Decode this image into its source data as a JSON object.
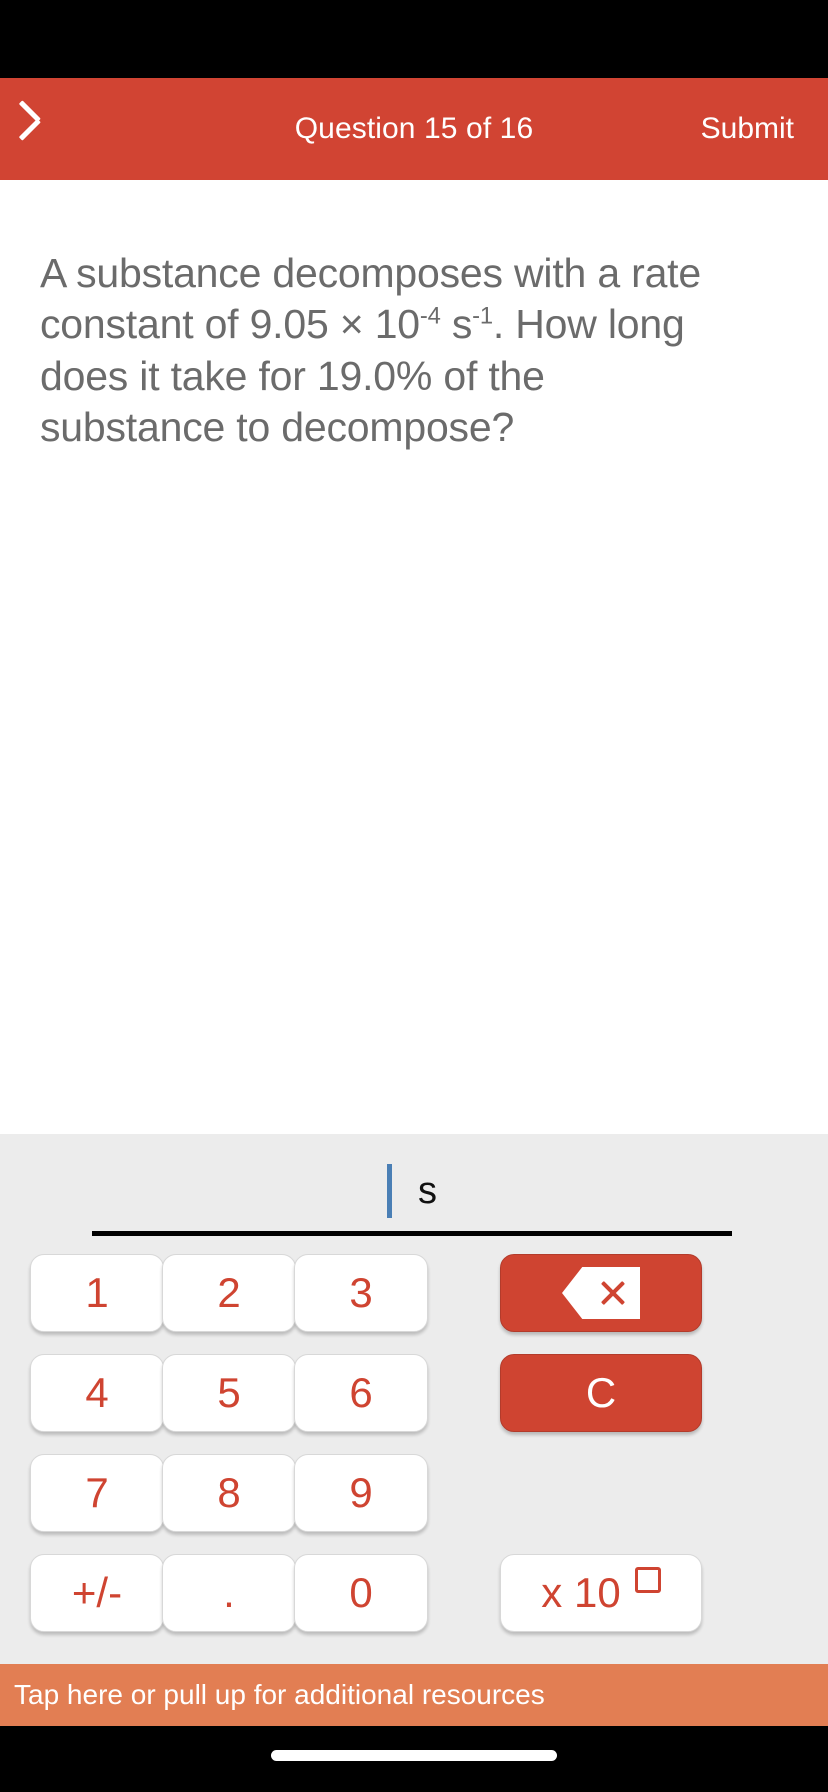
{
  "header": {
    "back_icon": "chevron-left-icon",
    "title": "Question 15 of 16",
    "submit_label": "Submit",
    "background_color": "#d14433",
    "text_color": "#ffffff"
  },
  "question": {
    "line1": "A substance decomposes with a rate constant of 9.05 × 10",
    "exp1": "-4",
    "line1b": " s",
    "exp2": "-1",
    "line1c": ". How long does it take for 19.0% of the substance to decompose?",
    "text_color": "#6b6b6b"
  },
  "answer": {
    "value": "",
    "caret_color": "#4a7fb5",
    "unit": "s",
    "underline_color": "#000000"
  },
  "keypad": {
    "background_color": "#ececec",
    "key_text_color": "#cf4431",
    "action_key_color": "#cf4431",
    "keys": [
      {
        "name": "key-1",
        "label": "1"
      },
      {
        "name": "key-2",
        "label": "2"
      },
      {
        "name": "key-3",
        "label": "3"
      },
      {
        "name": "key-4",
        "label": "4"
      },
      {
        "name": "key-5",
        "label": "5"
      },
      {
        "name": "key-6",
        "label": "6"
      },
      {
        "name": "key-7",
        "label": "7"
      },
      {
        "name": "key-8",
        "label": "8"
      },
      {
        "name": "key-9",
        "label": "9"
      },
      {
        "name": "key-sign",
        "label": "+/-"
      },
      {
        "name": "key-decimal",
        "label": "."
      },
      {
        "name": "key-0",
        "label": "0"
      }
    ],
    "backspace": {
      "icon": "backspace-icon",
      "label": ""
    },
    "clear": {
      "label": "C"
    },
    "exponent": {
      "prefix": "x 10",
      "placeholder_box": "□"
    }
  },
  "banner": {
    "text": "Tap here or pull up for additional resources",
    "background_color": "#e27e53",
    "text_color": "#ffffff"
  }
}
